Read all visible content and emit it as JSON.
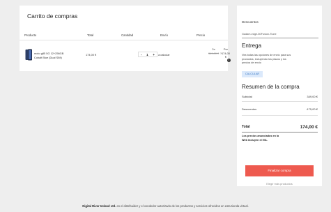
{
  "cart": {
    "title": "Carrito de compras",
    "headers": {
      "product": "Producto",
      "total": "Total",
      "quantity": "Cantidad",
      "shipping": "Envío",
      "price": "Precio"
    },
    "item": {
      "name_line1": "moto g85 5G 12+256GB",
      "name_line2": "Cobalt Blue (Dual SIM)",
      "total": "174,00 €",
      "quantity": "1",
      "minus": "-",
      "plus": "+",
      "shipping": "a calcular",
      "price_from_label": "De",
      "price_old": "349,00 €",
      "price_to_label": "Por",
      "price_new": "174,00 €",
      "remove": "×",
      "info": "i"
    }
  },
  "side": {
    "discounts_label": "Descuentos",
    "discount_code": "Gadam-edge-50Fusion-Tiune",
    "delivery_title": "Entrega",
    "delivery_text": "Vea todas las opciones de envío para sus productos, incluyendo los plazos y los precios de envío",
    "calculate_button": "CALCULAR",
    "summary_title": "Resumen de la compra",
    "subtotal_label": "Subtotal",
    "subtotal_value": "349,00 €",
    "discounts_row_label": "Descuentos",
    "discounts_value": "-175,00 €",
    "total_label": "Total",
    "total_value": "174,00 €",
    "tax_note": "Los precios anunciados en la Web incluyen el IVA.",
    "checkout_button": "Finalizar compra",
    "more_products": "Elegir más productos"
  },
  "footer": {
    "company": "Digital River Ireland Ltd.",
    "text": " es el distribuidor y el vendedor autorizado de los productos y servicios ofrecidos en esta tienda virtual."
  },
  "colors": {
    "checkout": "#ee5a4f",
    "calculate_bg": "#dbe9fb",
    "calculate_text": "#3a78c3"
  }
}
